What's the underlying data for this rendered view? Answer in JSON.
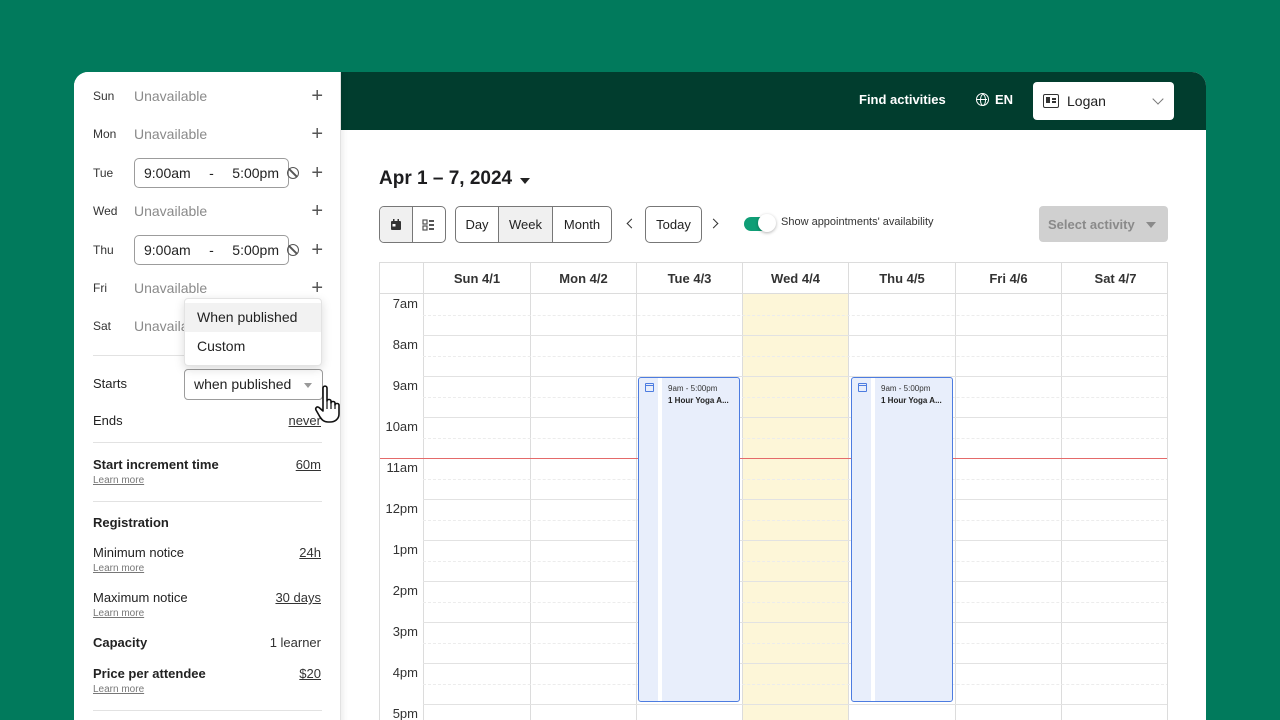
{
  "availability": {
    "days": [
      {
        "label": "Sun",
        "value": "Unavailable"
      },
      {
        "label": "Mon",
        "value": "Unavailable"
      },
      {
        "label": "Tue",
        "start": "9:00am",
        "end": "5:00pm"
      },
      {
        "label": "Wed",
        "value": "Unavailable"
      },
      {
        "label": "Thu",
        "start": "9:00am",
        "end": "5:00pm"
      },
      {
        "label": "Fri",
        "value": "Unavailable"
      },
      {
        "label": "Sat",
        "value": "Unavaila"
      }
    ],
    "separator": "-",
    "dropdown_options": [
      "When published",
      "Custom"
    ],
    "starts_label": "Starts",
    "starts_value": "when published",
    "ends_label": "Ends",
    "ends_value": "never"
  },
  "settings": {
    "start_increment_label": "Start increment time",
    "start_increment_value": "60m",
    "learn_more": "Learn more",
    "registration_heading": "Registration",
    "min_notice_label": "Minimum notice",
    "min_notice_value": "24h",
    "max_notice_label": "Maximum notice",
    "max_notice_value": "30 days",
    "capacity_label": "Capacity",
    "capacity_value": "1 learner",
    "price_label": "Price per attendee",
    "price_value": "$20"
  },
  "topbar": {
    "find_activities": "Find activities",
    "language": "EN",
    "user": "Logan"
  },
  "calendar": {
    "range_title": "Apr 1 – 7, 2024",
    "views": [
      "Day",
      "Week",
      "Month"
    ],
    "selected_view": "Week",
    "today_label": "Today",
    "toggle_label": "Show appointments' availability",
    "select_activity": "Select activity",
    "columns": [
      "Sun 4/1",
      "Mon 4/2",
      "Tue 4/3",
      "Wed 4/4",
      "Thu 4/5",
      "Fri 4/6",
      "Sat 4/7"
    ],
    "hours": [
      "7am",
      "8am",
      "9am",
      "10am",
      "11am",
      "12pm",
      "1pm",
      "2pm",
      "3pm",
      "4pm",
      "5pm"
    ],
    "events": [
      {
        "day_index": 2,
        "time": "9am - 5:00pm",
        "title": "1 Hour Yoga A..."
      },
      {
        "day_index": 4,
        "time": "9am - 5:00pm",
        "title": "1 Hour Yoga A..."
      }
    ]
  },
  "colors": {
    "background": "#017a5c",
    "topbar": "#013d2e",
    "accent": "#0f9e76",
    "event_border": "#4d7ce0",
    "highlight_day": "#fdf6d8",
    "now_line": "#e46a6a"
  }
}
